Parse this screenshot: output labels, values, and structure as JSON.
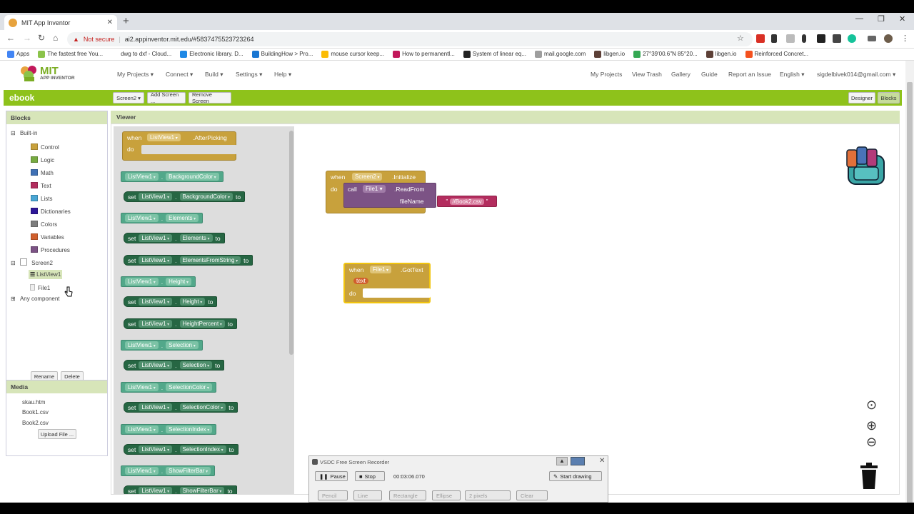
{
  "browser": {
    "tab_title": "MIT App Inventor",
    "new_tab": "+",
    "tab_close": "✕",
    "security": "Not secure",
    "url": "ai2.appinventor.mit.edu/#5837475523723264",
    "window_controls": [
      "—",
      "❐",
      "✕"
    ],
    "bookmarks": [
      {
        "label": "Apps",
        "color": "#4285f4"
      },
      {
        "label": "The fastest free You...",
        "color": "#8bc34a"
      },
      {
        "label": "dwg to dxf - Cloud...",
        "color": "#ffffff"
      },
      {
        "label": "Electronic library. D...",
        "color": "#1e88e5"
      },
      {
        "label": "BuildingHow > Pro...",
        "color": "#1976d2"
      },
      {
        "label": "mouse cursor keep...",
        "color": "#fbbc05"
      },
      {
        "label": "How to permanentl...",
        "color": "#c2185b"
      },
      {
        "label": "System of linear eq...",
        "color": "#222222"
      },
      {
        "label": "mail.google.com",
        "color": "#9e9e9e"
      },
      {
        "label": "libgen.io",
        "color": "#5d4037"
      },
      {
        "label": "27°39'00.6\"N 85°20...",
        "color": "#34a853"
      },
      {
        "label": "libgen.io",
        "color": "#5d4037"
      },
      {
        "label": "Reinforced Concret...",
        "color": "#f4511e"
      }
    ]
  },
  "app": {
    "logo_text": "MIT",
    "logo_sub": "APP INVENTOR",
    "menus": [
      "My Projects ▾",
      "Connect ▾",
      "Build ▾",
      "Settings ▾",
      "Help ▾"
    ],
    "right_menus": [
      "My Projects",
      "View Trash",
      "Gallery",
      "Guide",
      "Report an Issue",
      "English ▾",
      "sigdelbivek014@gmail.com ▾"
    ],
    "project_name": "ebook",
    "screen_buttons": [
      "Screen2 ▾",
      "Add Screen ...",
      "Remove Screen"
    ],
    "mode_buttons": [
      "Designer",
      "Blocks"
    ]
  },
  "blocks_panel": {
    "title": "Blocks",
    "builtin_label": "Built-in",
    "builtin": [
      {
        "label": "Control",
        "color": "#c8a13c"
      },
      {
        "label": "Logic",
        "color": "#77ab41"
      },
      {
        "label": "Math",
        "color": "#3f71b5"
      },
      {
        "label": "Text",
        "color": "#b32d5e"
      },
      {
        "label": "Lists",
        "color": "#49a6d4"
      },
      {
        "label": "Dictionaries",
        "color": "#2d1799"
      },
      {
        "label": "Colors",
        "color": "#7d7d7d"
      },
      {
        "label": "Variables",
        "color": "#d05f2d"
      },
      {
        "label": "Procedures",
        "color": "#7c5385"
      }
    ],
    "screen": "Screen2",
    "components": [
      "ListView1",
      "File1"
    ],
    "any_component": "Any component",
    "rename": "Rename",
    "delete": "Delete",
    "expand": "⊟",
    "collapse": "⊞"
  },
  "media_panel": {
    "title": "Media",
    "files": [
      "skau.htm",
      "Book1.csv",
      "Book2.csv"
    ],
    "upload": "Upload File ..."
  },
  "viewer": {
    "title": "Viewer",
    "flyout": {
      "event": {
        "when": "when",
        "component": "ListView1",
        "event": ".AfterPicking",
        "do": "do"
      },
      "blocks": [
        {
          "kind": "get",
          "comp": "ListView1",
          "prop": "BackgroundColor"
        },
        {
          "kind": "set",
          "comp": "ListView1",
          "prop": "BackgroundColor"
        },
        {
          "kind": "get",
          "comp": "ListView1",
          "prop": "Elements"
        },
        {
          "kind": "set",
          "comp": "ListView1",
          "prop": "Elements"
        },
        {
          "kind": "set",
          "comp": "ListView1",
          "prop": "ElementsFromString"
        },
        {
          "kind": "get",
          "comp": "ListView1",
          "prop": "Height"
        },
        {
          "kind": "set",
          "comp": "ListView1",
          "prop": "Height"
        },
        {
          "kind": "set",
          "comp": "ListView1",
          "prop": "HeightPercent"
        },
        {
          "kind": "get",
          "comp": "ListView1",
          "prop": "Selection"
        },
        {
          "kind": "set",
          "comp": "ListView1",
          "prop": "Selection"
        },
        {
          "kind": "get",
          "comp": "ListView1",
          "prop": "SelectionColor"
        },
        {
          "kind": "set",
          "comp": "ListView1",
          "prop": "SelectionColor"
        },
        {
          "kind": "get",
          "comp": "ListView1",
          "prop": "SelectionIndex"
        },
        {
          "kind": "set",
          "comp": "ListView1",
          "prop": "SelectionIndex"
        },
        {
          "kind": "get",
          "comp": "ListView1",
          "prop": "ShowFilterBar"
        },
        {
          "kind": "set",
          "comp": "ListView1",
          "prop": "ShowFilterBar"
        }
      ],
      "set_word": "set",
      "to_word": "to"
    },
    "init_block": {
      "when": "when",
      "component": "Screen2",
      "event": ".Initialize",
      "do": "do",
      "call": "call",
      "call_comp": "File1",
      "method": ".ReadFrom",
      "param": "fileName",
      "string": "//Book2.csv",
      "quote": "\""
    },
    "gottext_block": {
      "when": "when",
      "component": "File1",
      "event": ".GotText",
      "param": "text",
      "do": "do"
    }
  },
  "recorder": {
    "title": "VSDC Free Screen Recorder",
    "pause": "Pause",
    "stop": "Stop",
    "time": "00:03:06.070",
    "start_drawing": "Start drawing",
    "tools": [
      "Pencil",
      "Line",
      "Rectangle",
      "Ellipse",
      "2 pixels",
      "Clear"
    ]
  }
}
